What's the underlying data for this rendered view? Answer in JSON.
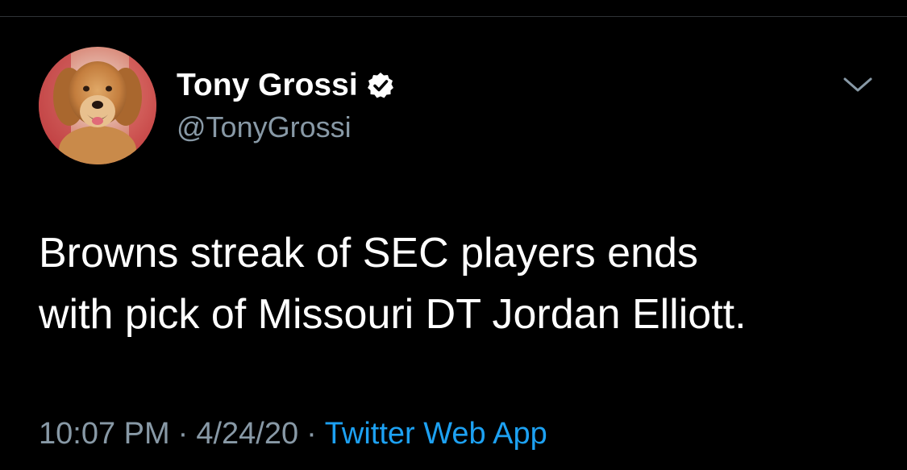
{
  "theme": {
    "background": "#000000",
    "text": "#ffffff",
    "secondary_text": "#8899a6",
    "link": "#1da1f2"
  },
  "author": {
    "avatar_icon": "golden-retriever-avatar",
    "display_name": "Tony Grossi",
    "verified_icon": "verified-badge-icon",
    "handle": "@TonyGrossi"
  },
  "menu": {
    "icon": "chevron-down-icon"
  },
  "tweet": {
    "lines": [
      "Browns streak of SEC players ends",
      "with pick of Missouri DT Jordan Elliott."
    ]
  },
  "meta": {
    "time": "10:07 PM",
    "separator": "·",
    "date": "4/24/20",
    "source": "Twitter Web App"
  }
}
